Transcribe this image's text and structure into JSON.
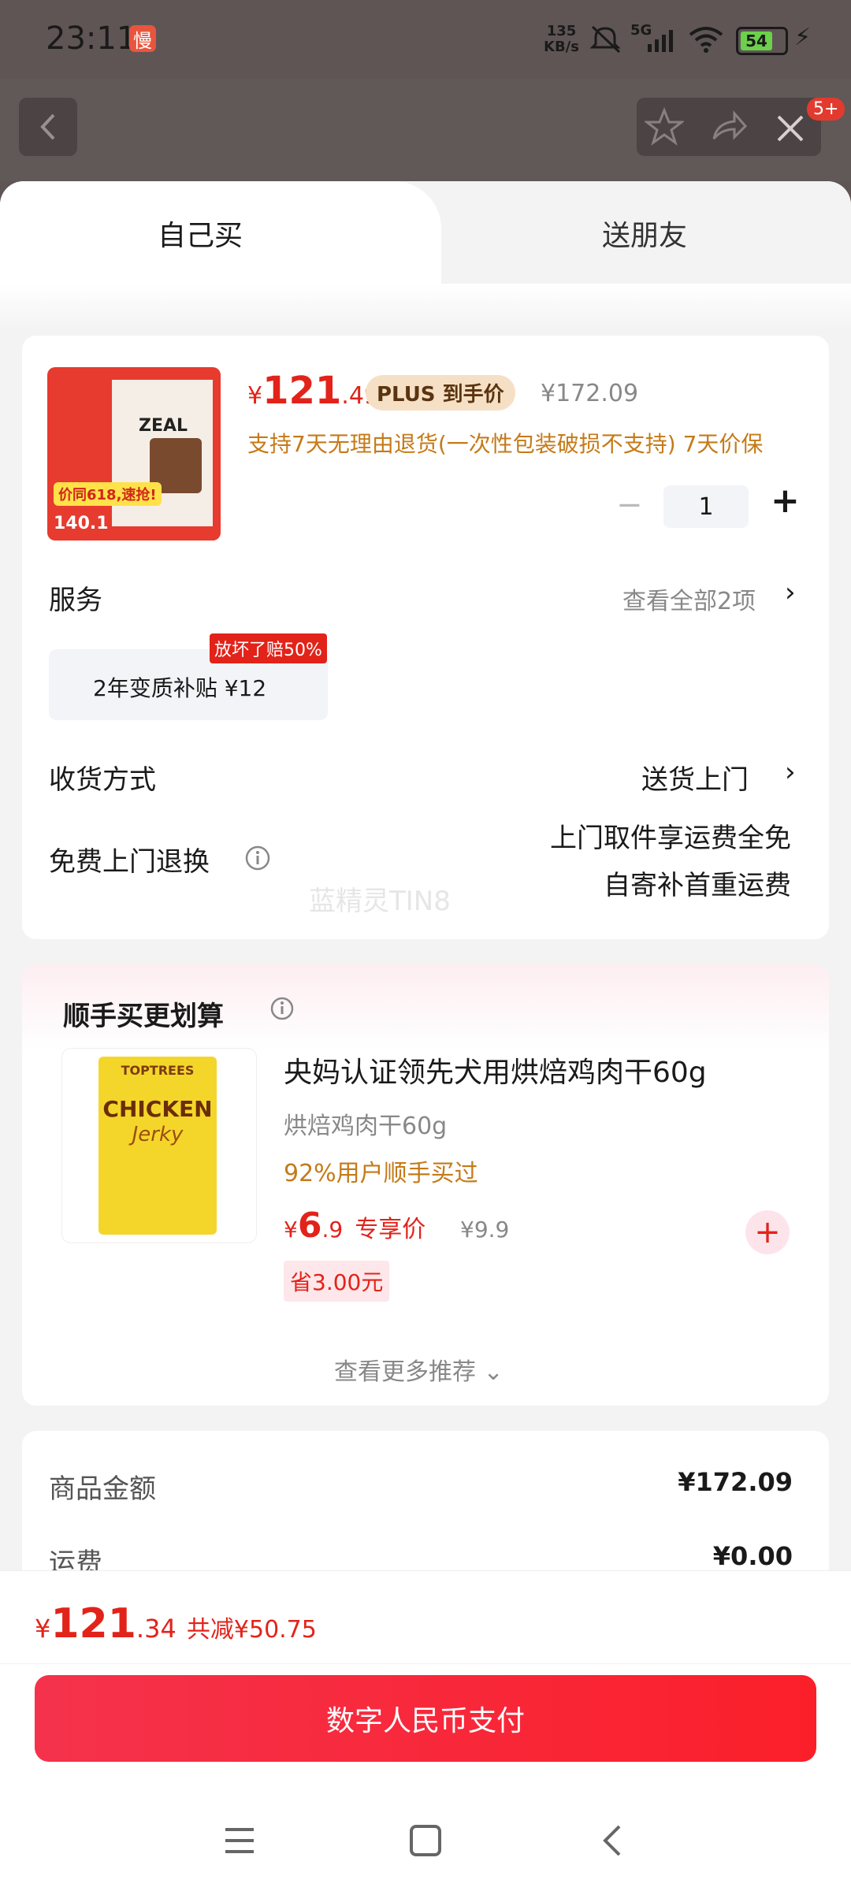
{
  "status": {
    "time": "23:11",
    "app_badge": "慢",
    "net_speed_top": "135",
    "net_speed_unit": "KB/s",
    "signal": "5G",
    "battery": "54"
  },
  "header": {
    "notification_count": "5+"
  },
  "tabs": {
    "self": "自己买",
    "friend": "送朋友"
  },
  "product": {
    "image_banner": "价同618,速抢!",
    "image_price": "140.1",
    "image_brand": "ZEAL",
    "price_symbol": "¥",
    "price_int": "121",
    "price_dec": ".49",
    "plus_tag": "PLUS 到手价",
    "original_price": "¥172.09",
    "return_policy": "支持7天无理由退货(一次性包装破损不支持)  7天价保",
    "quantity": "1",
    "minus": "−",
    "plus": "+"
  },
  "service": {
    "label": "服务",
    "view_all": "查看全部2项",
    "badge": "放坏了赔50%",
    "option": "2年变质补贴  ¥12"
  },
  "delivery": {
    "label": "收货方式",
    "value": "送货上门"
  },
  "returns": {
    "label": "免费上门退换",
    "line1": "上门取件享运费全免",
    "line2": "自寄补首重运费"
  },
  "watermark": "蓝精灵TIN8",
  "recommend": {
    "title": "顺手买更划算",
    "item_title": "央妈认证领先犬用烘焙鸡肉干60g",
    "item_sub": "烘焙鸡肉干60g",
    "item_stat": "92%用户顺手买过",
    "price_symbol": "¥",
    "price_int": "6",
    "price_dec": ".9",
    "price_label": "专享价",
    "original": "¥9.9",
    "save": "省3.00元",
    "img_brand": "TOPTREES",
    "img_main": "CHICKEN",
    "img_sub": "Jerky",
    "more": "查看更多推荐"
  },
  "summary": {
    "goods_label": "商品金额",
    "goods_value": "¥172.09",
    "ship_label": "运费",
    "ship_value": "¥0.00"
  },
  "footer": {
    "total_symbol": "¥",
    "total_int": "121",
    "total_dec": ".34",
    "discount": "共减¥50.75",
    "pay_button": "数字人民币支付"
  }
}
